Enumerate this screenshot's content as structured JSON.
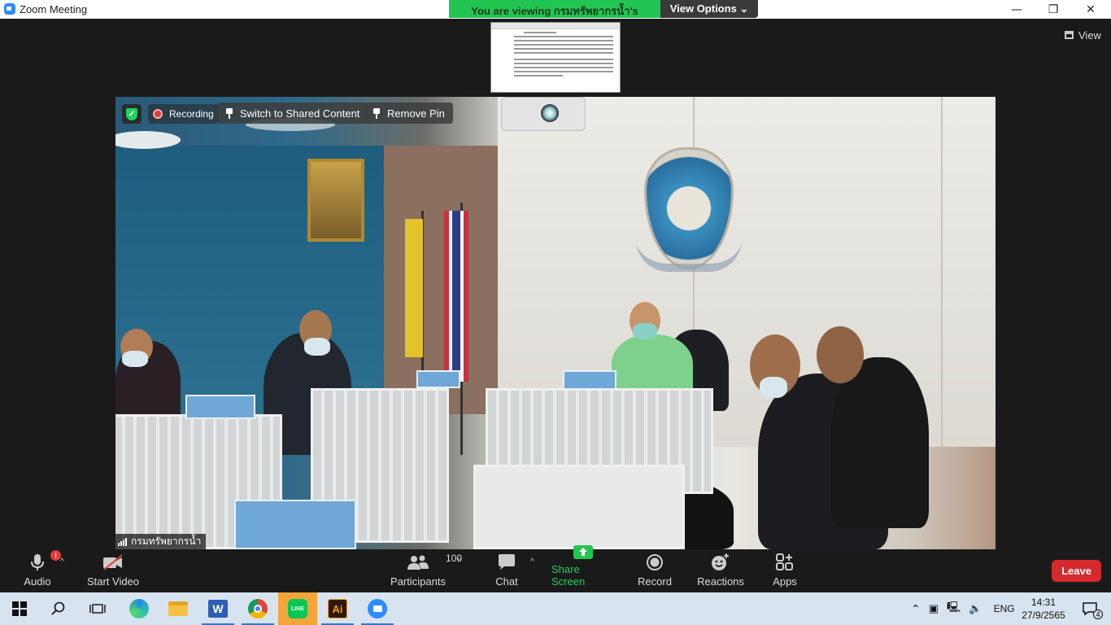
{
  "window": {
    "title": "Zoom Meeting",
    "minimize": "—",
    "restore": "❐",
    "close": "✕"
  },
  "share_banner": {
    "viewing_text": "You are viewing กรมทรัพยากรน้ำ's screen",
    "view_options": "View Options ⌄"
  },
  "view_button": {
    "label": "View"
  },
  "video": {
    "recording_label": "Recording",
    "switch_label": "Switch to Shared Content",
    "remove_pin_label": "Remove Pin",
    "participant_name": "กรมทรัพยากรน้ำ"
  },
  "toolbar": {
    "audio_label": "Audio",
    "audio_alert": "!",
    "video_label": "Start Video",
    "participants_label": "Participants",
    "participants_count": "100",
    "chat_label": "Chat",
    "share_label": "Share Screen",
    "record_label": "Record",
    "reactions_label": "Reactions",
    "apps_label": "Apps",
    "leave_label": "Leave",
    "caret": "^"
  },
  "taskbar": {
    "language": "ENG",
    "time": "14:31",
    "date": "27/9/2565",
    "notification_count": "4",
    "line_label": "LINE",
    "ai_label": "Ai"
  },
  "colors": {
    "share_green": "#23c552",
    "leave_red": "#d6292d",
    "zoom_blue": "#2d8cff"
  }
}
